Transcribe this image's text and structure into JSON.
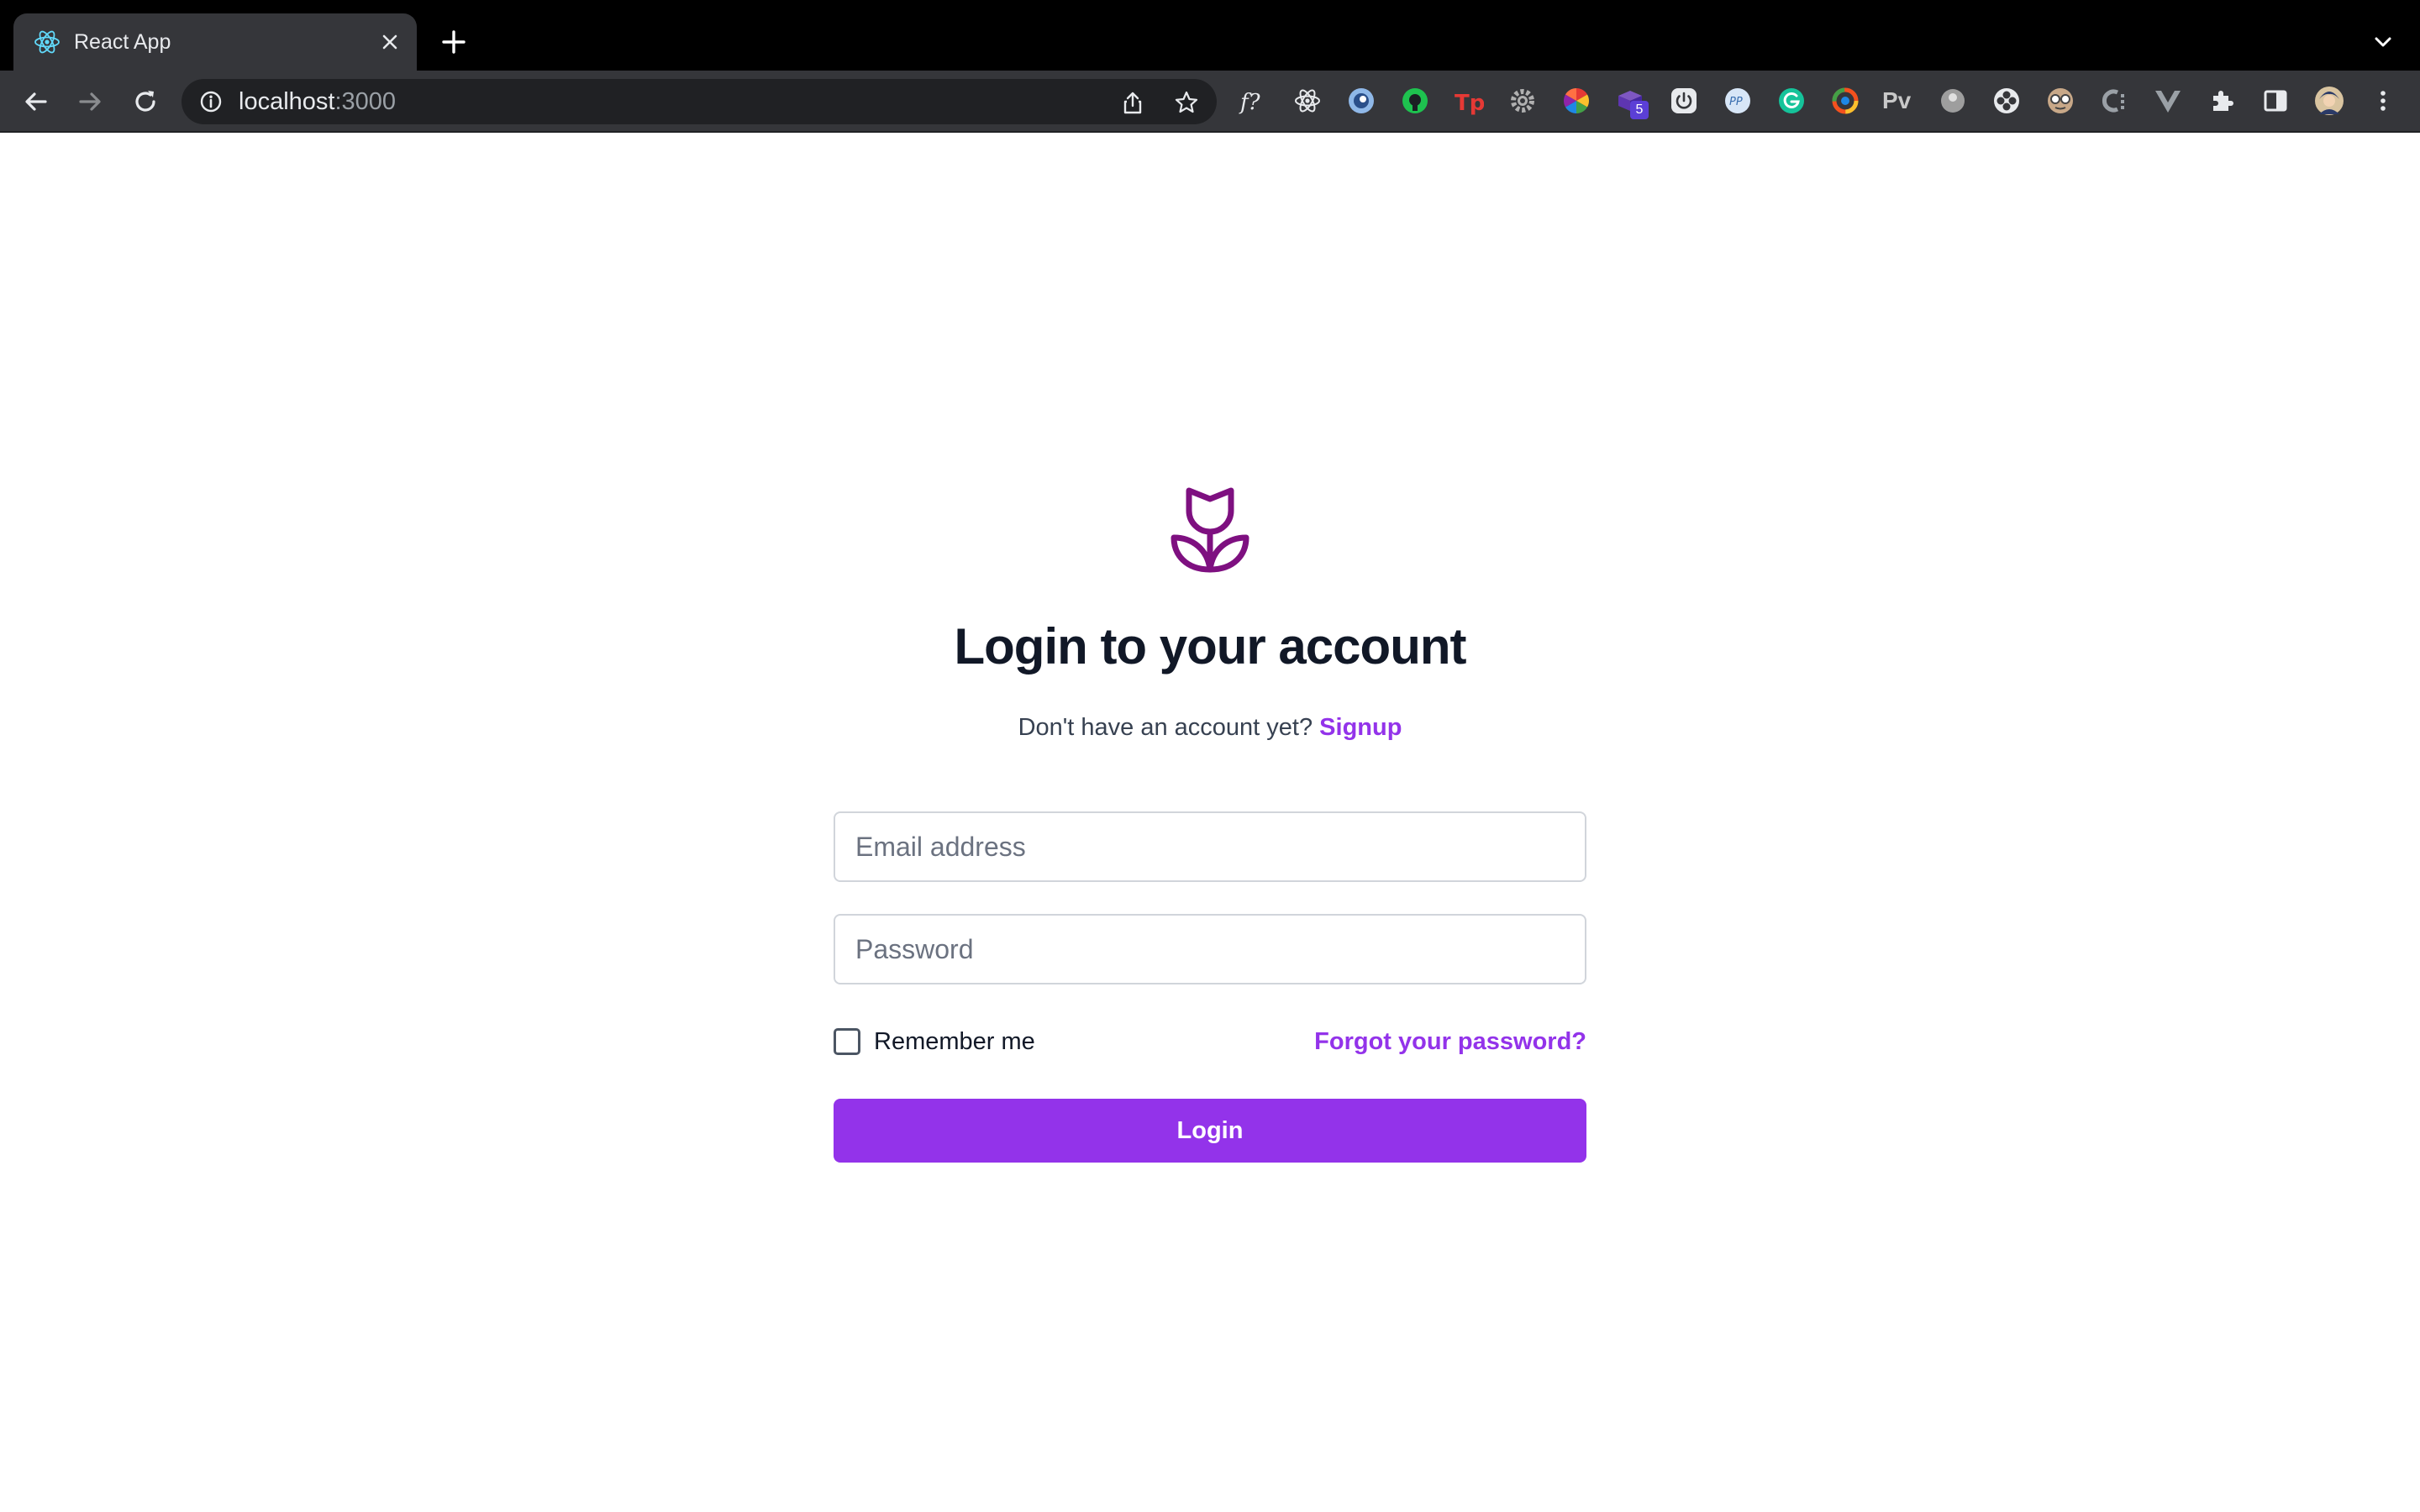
{
  "browser": {
    "tab": {
      "title": "React App",
      "favicon": "react-icon"
    },
    "address": {
      "host": "localhost",
      "port": ":3000"
    },
    "extensions_text": {
      "pv": "Pv"
    },
    "extension_badge": "5"
  },
  "page": {
    "title": "Login to your account",
    "signup_prompt": "Don't have an account yet? ",
    "signup_link": "Signup",
    "email_placeholder": "Email address",
    "password_placeholder": "Password",
    "remember_label": "Remember me",
    "forgot_link": "Forgot your password?",
    "login_label": "Login"
  },
  "colors": {
    "accent": "#9333ea",
    "logo": "#7e1080",
    "title": "#111827",
    "chrome_dark": "#000000",
    "chrome_toolbar": "#35363a"
  }
}
